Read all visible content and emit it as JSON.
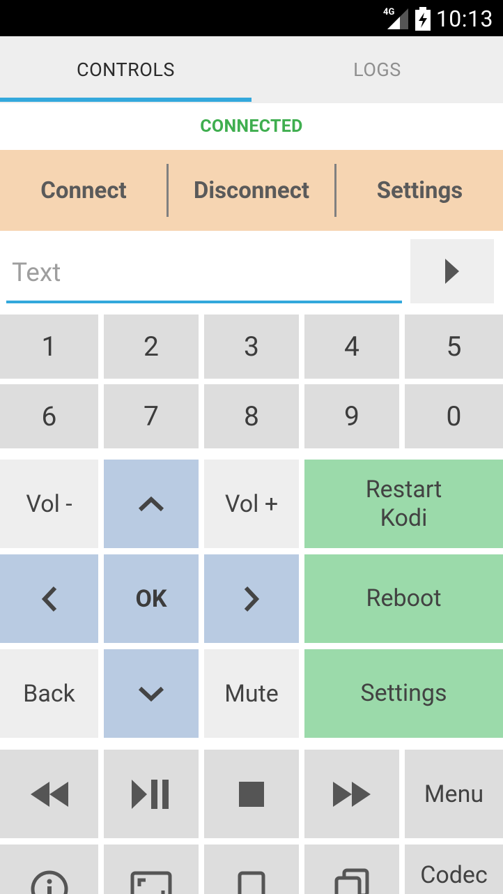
{
  "status_bar": {
    "network": "4G",
    "time": "10:13"
  },
  "tabs": [
    {
      "label": "CONTROLS"
    },
    {
      "label": "LOGS"
    }
  ],
  "connection_status": "CONNECTED",
  "actions": {
    "connect": "Connect",
    "disconnect": "Disconnect",
    "settings": "Settings"
  },
  "text_input": {
    "placeholder": "Text",
    "value": ""
  },
  "numpad": [
    "1",
    "2",
    "3",
    "4",
    "5",
    "6",
    "7",
    "8",
    "9",
    "0"
  ],
  "controls": {
    "vol_down": "Vol -",
    "vol_up": "Vol +",
    "ok": "OK",
    "back": "Back",
    "mute": "Mute",
    "restart_kodi": "Restart Kodi",
    "reboot": "Reboot",
    "settings": "Settings",
    "menu": "Menu",
    "codec": "Codec"
  },
  "icons": {
    "send": "play-arrow-icon",
    "up": "chevron-up-icon",
    "down": "chevron-down-icon",
    "left": "chevron-left-icon",
    "right": "chevron-right-icon",
    "rewind": "rewind-icon",
    "play_pause": "play-pause-icon",
    "stop": "stop-icon",
    "fast_forward": "fast-forward-icon",
    "info": "info-icon",
    "fullscreen": "fullscreen-icon",
    "square": "square-icon",
    "copy": "copy-icon"
  },
  "colors": {
    "accent": "#33a8dc",
    "connected": "#3fae4f",
    "action_bar": "#f6d5b2",
    "nav_button": "#b9cbe2",
    "system_button": "#9bdaaa"
  }
}
